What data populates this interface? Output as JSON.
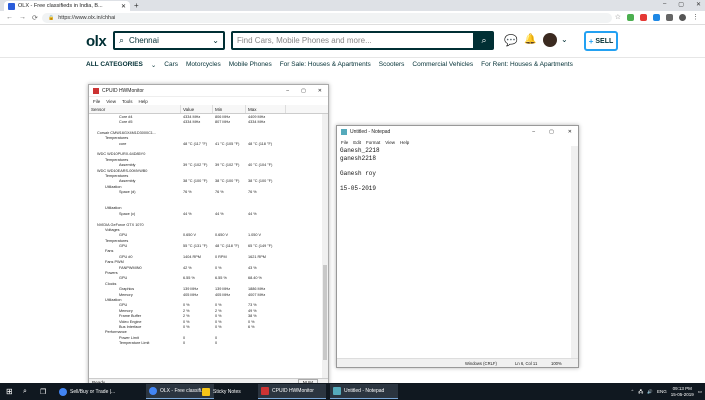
{
  "browser": {
    "tab_title": "OLX - Free classifieds in India, B...",
    "url": "https://www.olx.in/chhai",
    "new_tab": "+"
  },
  "olx": {
    "logo": "olx",
    "location": "Chennai",
    "search_placeholder": "Find Cars, Mobile Phones and more...",
    "sell_label": "SELL",
    "categories": [
      "ALL CATEGORIES",
      "Cars",
      "Motorcycles",
      "Mobile Phones",
      "For Sale: Houses & Apartments",
      "Scooters",
      "Commercial Vehicles",
      "For Rent: Houses & Apartments"
    ]
  },
  "hwmonitor": {
    "title": "CPUID HWMonitor",
    "menu": [
      "File",
      "View",
      "Tools",
      "Help"
    ],
    "columns": [
      "Sensor",
      "Value",
      "Min",
      "Max"
    ],
    "rows": [
      [
        "Core #4",
        "4334 MHz",
        "806 MHz",
        "4409 MHz"
      ],
      [
        "Core #5",
        "4334 MHz",
        "807 MHz",
        "4334 MHz"
      ],
      [
        "",
        "",
        " ",
        ""
      ],
      [
        "Corsair CMW16GX4M1D3000C1...",
        "",
        "",
        ""
      ],
      [
        "Temperatures",
        "",
        "",
        ""
      ],
      [
        "core",
        "48 °C (117 °F)",
        "41 °C (105 °F)",
        "48 °C (118 °F)"
      ],
      [
        "",
        "",
        " ",
        ""
      ],
      [
        "WDC WD10PURX-64D85Y0",
        "",
        "",
        ""
      ],
      [
        "Temperatures",
        "",
        "",
        ""
      ],
      [
        "Assembly",
        "39 °C (102 °F)",
        "39 °C (102 °F)",
        "40 °C (104 °F)"
      ],
      [
        "WDC WD10EARS-00MVWB0",
        "",
        "",
        ""
      ],
      [
        "Temperatures",
        "",
        "",
        ""
      ],
      [
        "Assembly",
        "38 °C (100 °F)",
        "38 °C (100 °F)",
        "38 °C (100 °F)"
      ],
      [
        "Utilization",
        "",
        "",
        ""
      ],
      [
        "Space (d)",
        "76 %",
        "76 %",
        "76 %"
      ],
      [
        "",
        "",
        " ",
        ""
      ],
      [
        "",
        "",
        "",
        ""
      ],
      [
        "Utilization",
        "",
        "",
        ""
      ],
      [
        "Space (c)",
        "44 %",
        "44 %",
        "44 %"
      ],
      [
        "",
        "",
        " ",
        ""
      ],
      [
        "NVIDIA GeForce GTX 1070",
        "",
        "",
        ""
      ],
      [
        "Voltages",
        "",
        "",
        ""
      ],
      [
        "GPU",
        "0.650 V",
        "0.650 V",
        "1.050 V"
      ],
      [
        "Temperatures",
        "",
        "",
        ""
      ],
      [
        "GPU",
        "55 °C (131 °F)",
        "48 °C (118 °F)",
        "65 °C (149 °F)"
      ],
      [
        "Fans",
        "",
        "",
        ""
      ],
      [
        "GPU #0",
        "1404 RPM",
        "0 RPM",
        "1621 RPM"
      ],
      [
        "Fans PWM",
        "",
        "",
        ""
      ],
      [
        "FANPWMIN0",
        "42 %",
        "0 %",
        "43 %"
      ],
      [
        "Powers",
        "",
        "",
        ""
      ],
      [
        "GPU",
        "6.55 %",
        "6.55 %",
        "68.40 %"
      ],
      [
        "Clocks",
        "",
        "",
        ""
      ],
      [
        "Graphics",
        "139 MHz",
        "139 MHz",
        "1886 MHz"
      ],
      [
        "Memory",
        "405 MHz",
        "405 MHz",
        "4007 MHz"
      ],
      [
        "Utilization",
        "",
        "",
        ""
      ],
      [
        "GPU",
        "0 %",
        "0 %",
        "73 %"
      ],
      [
        "Memory",
        "2 %",
        "2 %",
        "49 %"
      ],
      [
        "Frame Buffer",
        "2 %",
        "0 %",
        "38 %"
      ],
      [
        "Video Engine",
        "0 %",
        "0 %",
        "0 %"
      ],
      [
        "Bus Interface",
        "0 %",
        "0 %",
        "6 %"
      ],
      [
        "Performance",
        "",
        "",
        ""
      ],
      [
        "Power Limit",
        "0",
        "0",
        ""
      ],
      [
        "Temperature Limit",
        "0",
        "0",
        ""
      ]
    ],
    "status": "Ready",
    "num": "NUM"
  },
  "notepad": {
    "title": "Untitled - Notepad",
    "menu": [
      "File",
      "Edit",
      "Format",
      "View",
      "Help"
    ],
    "lines": [
      "Ganesh_2218",
      "ganesh2218",
      "",
      "Ganesh roy",
      "",
      "15-05-2019"
    ],
    "status_encoding": "Windows (CRLF)",
    "status_pos": "Ln 6, Col 11",
    "status_zoom": "100%"
  },
  "taskbar": {
    "apps": [
      "Sell/Buy or Trade |...",
      "OLX - Free classifi...",
      "Sticky Notes",
      "CPUID HWMonitor",
      "Untitled - Notepad"
    ],
    "lang": "ENG",
    "time": "09:13 PM",
    "date": "15-05-2019"
  }
}
